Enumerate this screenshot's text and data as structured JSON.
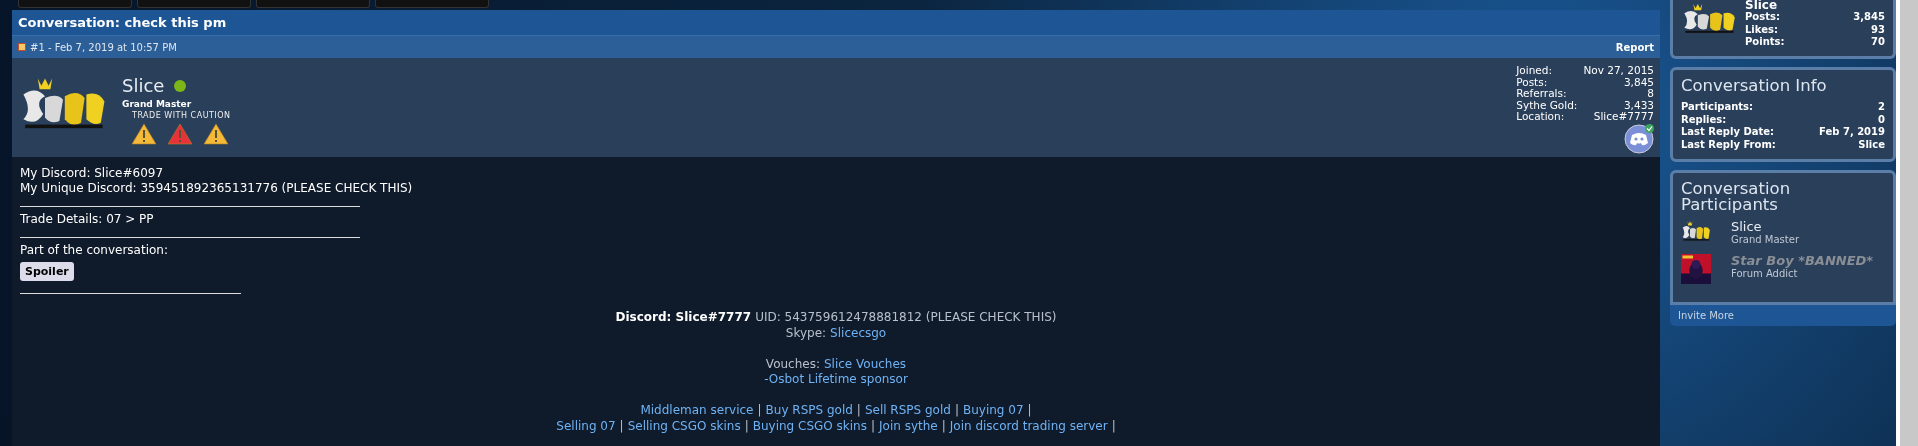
{
  "nav_tabs": [
    {
      "kind": "tab"
    },
    {
      "kind": "tab"
    },
    {
      "kind": "tab"
    },
    {
      "kind": "tab"
    }
  ],
  "title": "Conversation: check this pm",
  "post": {
    "meta": "#1 - Feb 7, 2019 at 10:57 PM",
    "report": "Report",
    "author": {
      "name": "Slice",
      "online": true,
      "rank": "Grand Master",
      "warning_label": "TRADE WITH CAUTION",
      "warnings": [
        {
          "kind": "caution"
        },
        {
          "kind": "danger"
        },
        {
          "kind": "caution"
        }
      ]
    },
    "stats": [
      {
        "label": "Joined:",
        "value": "Nov 27, 2015"
      },
      {
        "label": "Posts:",
        "value": "3,845"
      },
      {
        "label": "Referrals:",
        "value": "8"
      },
      {
        "label": "Sythe Gold:",
        "value": "3,433"
      },
      {
        "label": "Location:",
        "value": "Slice#7777"
      }
    ],
    "discord_verified": true,
    "body": [
      {
        "kind": "text",
        "text": "My Discord: Slice#6097"
      },
      {
        "kind": "text",
        "text": "My Unique Discord: 359451892365131776 (PLEASE CHECK THIS)"
      },
      {
        "kind": "rule"
      },
      {
        "kind": "text",
        "text": "Trade Details: 07 > PP"
      },
      {
        "kind": "rule"
      },
      {
        "kind": "text",
        "text": "Part of the conversation:"
      },
      {
        "kind": "button",
        "text": "Spoiler"
      },
      {
        "kind": "short_rule"
      }
    ],
    "signature": [
      {
        "kind": "line",
        "segments": [
          {
            "kind": "bold",
            "text": "Discord: Slice#7777"
          },
          {
            "kind": "plain",
            "text": "UID: 543759612478881812 (PLEASE CHECK THIS)"
          }
        ]
      },
      {
        "kind": "line",
        "segments": [
          {
            "kind": "plain",
            "text": "Skype:"
          },
          {
            "kind": "link",
            "text": "Slicecsgo"
          }
        ]
      },
      {
        "kind": "blank"
      },
      {
        "kind": "line",
        "segments": [
          {
            "kind": "plain",
            "text": "Vouches:"
          },
          {
            "kind": "link",
            "text": "Slice Vouches"
          }
        ]
      },
      {
        "kind": "line",
        "segments": [
          {
            "kind": "link",
            "text": "-Osbot Lifetime sponsor"
          }
        ]
      },
      {
        "kind": "blank"
      },
      {
        "kind": "line",
        "segments": [
          {
            "kind": "link",
            "text": "Middleman service"
          },
          {
            "kind": "plain",
            "text": "|"
          },
          {
            "kind": "link",
            "text": "Buy RSPS gold"
          },
          {
            "kind": "plain",
            "text": "|"
          },
          {
            "kind": "link",
            "text": "Sell RSPS gold"
          },
          {
            "kind": "plain",
            "text": "|"
          },
          {
            "kind": "link",
            "text": "Buying 07"
          },
          {
            "kind": "plain",
            "text": "|"
          }
        ]
      },
      {
        "kind": "line",
        "segments": [
          {
            "kind": "link",
            "text": "Selling 07"
          },
          {
            "kind": "plain",
            "text": "|"
          },
          {
            "kind": "link",
            "text": "Selling CSGO skins"
          },
          {
            "kind": "plain",
            "text": "|"
          },
          {
            "kind": "link",
            "text": "Buying CSGO skins"
          },
          {
            "kind": "plain",
            "text": "|"
          },
          {
            "kind": "link",
            "text": "Join sythe"
          },
          {
            "kind": "plain",
            "text": "|"
          },
          {
            "kind": "link",
            "text": "Join discord trading server"
          },
          {
            "kind": "plain",
            "text": "|"
          }
        ]
      }
    ]
  },
  "sidebar": {
    "profile": {
      "name": "Slice",
      "stats": [
        {
          "label": "Posts:",
          "value": "3,845"
        },
        {
          "label": "Likes:",
          "value": "93"
        },
        {
          "label": "Points:",
          "value": "70"
        }
      ]
    },
    "info": {
      "title": "Conversation Info",
      "rows": [
        {
          "label": "Participants:",
          "value": "2"
        },
        {
          "label": "Replies:",
          "value": "0"
        },
        {
          "label": "Last Reply Date:",
          "value": "Feb 7, 2019"
        },
        {
          "label": "Last Reply From:",
          "value": "Slice"
        }
      ]
    },
    "participants": {
      "title": "Conversation Participants",
      "items": [
        {
          "name": "Slice",
          "rank": "Grand Master",
          "banned": false
        },
        {
          "name": "Star Boy *BANNED*",
          "rank": "Forum Addict",
          "banned": true
        }
      ]
    },
    "invite": "Invite More"
  }
}
